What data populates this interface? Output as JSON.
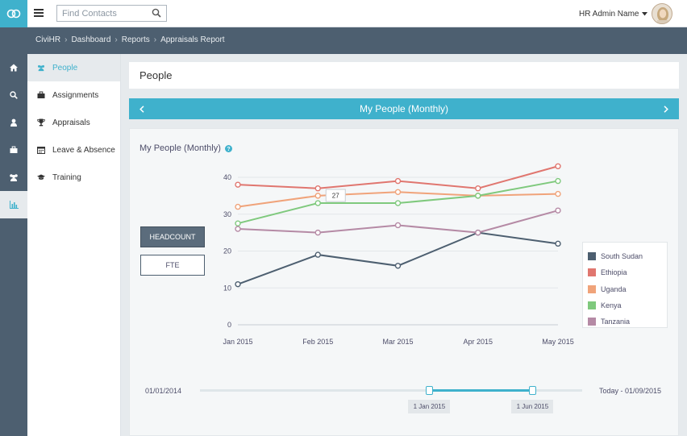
{
  "topbar": {
    "search_placeholder": "Find Contacts",
    "user_name": "HR Admin Name"
  },
  "breadcrumb": [
    "CiviHR",
    "Dashboard",
    "Reports",
    "Appraisals Report"
  ],
  "sidebar": {
    "items": [
      {
        "label": "People",
        "icon": "people-icon",
        "active": true
      },
      {
        "label": "Assignments",
        "icon": "briefcase-icon",
        "active": false
      },
      {
        "label": "Appraisals",
        "icon": "trophy-icon",
        "active": false
      },
      {
        "label": "Leave & Absence",
        "icon": "calendar-icon",
        "active": false
      },
      {
        "label": "Training",
        "icon": "graduation-cap-icon",
        "active": false
      }
    ]
  },
  "rail": {
    "icons": [
      "home-icon",
      "search-icon",
      "user-icon",
      "briefcase-icon",
      "people-icon",
      "bar-chart-icon"
    ]
  },
  "page": {
    "title": "People"
  },
  "carousel": {
    "title": "My People (Monthly)"
  },
  "card": {
    "title": "My People (Monthly)",
    "headcount_label": "HEADCOUNT",
    "fte_label": "FTE"
  },
  "chart_data": {
    "type": "line",
    "x": [
      "Jan 2015",
      "Feb 2015",
      "Mar 2015",
      "Apr 2015",
      "May 2015"
    ],
    "ylim": [
      0,
      40
    ],
    "yticks": [
      0,
      10,
      20,
      30,
      40
    ],
    "grid": true,
    "legend_position": "right",
    "tooltip": {
      "series": "Kenya",
      "x": "Feb 2015",
      "value": "27"
    },
    "series": [
      {
        "name": "South Sudan",
        "color": "#4d5f70",
        "values": [
          11,
          19,
          16,
          25,
          22
        ]
      },
      {
        "name": "Ethiopia",
        "color": "#e0766f",
        "values": [
          38,
          37,
          39,
          37,
          43
        ]
      },
      {
        "name": "Uganda",
        "color": "#f0a37a",
        "values": [
          32,
          35,
          36,
          35,
          35.5
        ]
      },
      {
        "name": "Kenya",
        "color": "#7fc97d",
        "values": [
          27.5,
          33,
          33,
          35,
          39
        ]
      },
      {
        "name": "Tanzania",
        "color": "#b58aa5",
        "values": [
          26,
          25,
          27,
          25,
          31
        ]
      }
    ]
  },
  "range": {
    "start_label": "01/01/2014",
    "end_label": "Today - 01/09/2015",
    "from_label": "1 Jan 2015",
    "to_label": "1 Jun 2015",
    "from_fraction": 0.6,
    "to_fraction": 0.87
  },
  "colors": {
    "accent": "#3fb1cc",
    "dark": "#4d5f70"
  }
}
